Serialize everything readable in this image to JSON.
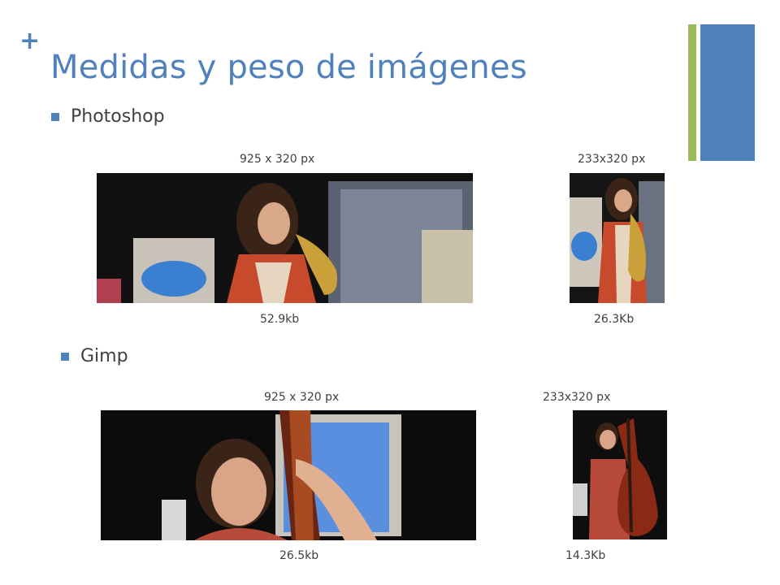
{
  "slide": {
    "plus_mark": "+",
    "title": "Medidas y peso de imágenes"
  },
  "photoshop": {
    "label": "Photoshop",
    "wide": {
      "dims": "925 x 320 px",
      "size": "52.9kb"
    },
    "narrow": {
      "dims": "233x320 px",
      "size": "26.3Kb"
    }
  },
  "gimp": {
    "label": "Gimp",
    "wide": {
      "dims": "925 x 320 px",
      "size": "26.5kb"
    },
    "narrow": {
      "dims": "233x320 px",
      "size": "14.3Kb"
    }
  },
  "colors": {
    "accent_blue": "#4f81bd",
    "accent_green": "#9bbb59",
    "text": "#404040"
  }
}
